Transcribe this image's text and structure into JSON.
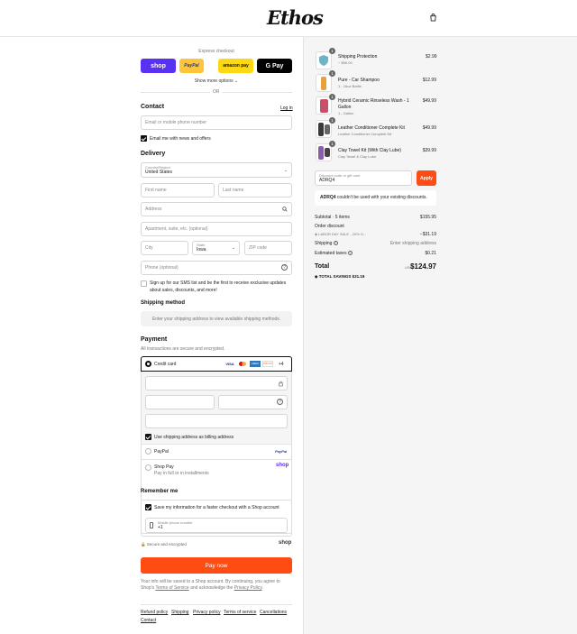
{
  "header": {
    "logo": "Ethos",
    "cart_icon": "shopping-bag-icon"
  },
  "express": {
    "title": "Express checkout",
    "shop_label": "shop",
    "paypal_label": "PayPal",
    "amazon_label": "amazon pay",
    "gpay_label": "G Pay",
    "more_options": "Show more options",
    "or": "OR"
  },
  "contact": {
    "title": "Contact",
    "login": "Log in",
    "email_placeholder": "Email or mobile phone number",
    "news_label": "Email me with news and offers"
  },
  "delivery": {
    "title": "Delivery",
    "country_label": "Country/Region",
    "country_value": "United States",
    "first_name": "First name",
    "last_name": "Last name",
    "address": "Address",
    "apartment": "Apartment, suite, etc. (optional)",
    "city": "City",
    "state_label": "State",
    "state_value": "Iowa",
    "zip": "ZIP code",
    "phone": "Phone (optional)",
    "sms_label": "Sign up for our SMS list and be the first to receive exclusive updates about sales, discounts, and more!"
  },
  "shipping_method": {
    "title": "Shipping method",
    "placeholder": "Enter your shipping address to view available shipping methods."
  },
  "payment": {
    "title": "Payment",
    "subtitle": "All transactions are secure and encrypted.",
    "credit_card": "Credit card",
    "card_brands": [
      "VISA",
      "MC",
      "AMEX",
      "DISCOVER"
    ],
    "more_brands": "+4",
    "billing_label": "Use shipping address as billing address",
    "paypal": "PayPal",
    "paypal_logo": "PayPal",
    "shoppay": "Shop Pay",
    "shoppay_sub": "Pay in full or in installments",
    "shoppay_logo": "shop"
  },
  "remember": {
    "title": "Remember me",
    "save_label": "Save my information for a faster checkout with a Shop account",
    "mobile_label": "Mobile phone number",
    "mobile_value": "+1",
    "secure": "Secure and encrypted",
    "shop_logo": "shop"
  },
  "pay_button": "Pay now",
  "legal": {
    "text": "Your info will be saved to a Shop account. By continuing, you agree to Shop's",
    "terms": "Terms of Service",
    "and": "and acknowledge the",
    "privacy": "Privacy Policy",
    "end": "."
  },
  "footer_links": [
    "Refund policy",
    "Shipping",
    "Privacy policy",
    "Terms of service",
    "Cancellations",
    "Contact"
  ],
  "order": {
    "items": [
      {
        "qty": "1",
        "name": "Shipping Protection",
        "variant": "~ $56.00",
        "price": "$2.99",
        "color": "#6fb3c9"
      },
      {
        "qty": "1",
        "name": "Pure - Car Shampoo",
        "variant": "1 - 16oz Bottle",
        "price": "$12.99",
        "color": "#e8a23a"
      },
      {
        "qty": "1",
        "name": "Hybrid Ceramic Rinseless Wash - 1 Gallon",
        "variant": "1 - Gallon",
        "price": "$49.99",
        "color": "#c9506b"
      },
      {
        "qty": "1",
        "name": "Leather Conditioner Complete Kit",
        "variant": "Leather Conditioner Complete Kit",
        "price": "$49.99",
        "color": "#3a3a3a"
      },
      {
        "qty": "1",
        "name": "Clay Towel Kit (With Clay Lube)",
        "variant": "Clay Towel & Clay Lube",
        "price": "$39.99",
        "color": "#8a5fa8"
      }
    ],
    "discount_label": "Discount code or gift card",
    "discount_value": "ADRQ4",
    "apply": "Apply",
    "error_code": "ADRQ4",
    "error_text": "couldn't be used with your existing discounts.",
    "subtotal_label": "Subtotal · 5 items",
    "subtotal": "$155.95",
    "order_discount": "Order discount",
    "discount_name": "LABOR DAY SALE - 20% O...",
    "discount_amount": "−$31.19",
    "shipping_label": "Shipping",
    "shipping_value": "Enter shipping address",
    "taxes_label": "Estimated taxes",
    "taxes_value": "$0.21",
    "total_label": "Total",
    "currency": "USD",
    "total": "$124.97",
    "savings_label": "TOTAL SAVINGS",
    "savings": "$31.19"
  },
  "colors": {
    "accent": "#ff4c12",
    "shop": "#5a31f4",
    "paypal_btn": "#ffc439",
    "amazon": "#ffd814"
  }
}
